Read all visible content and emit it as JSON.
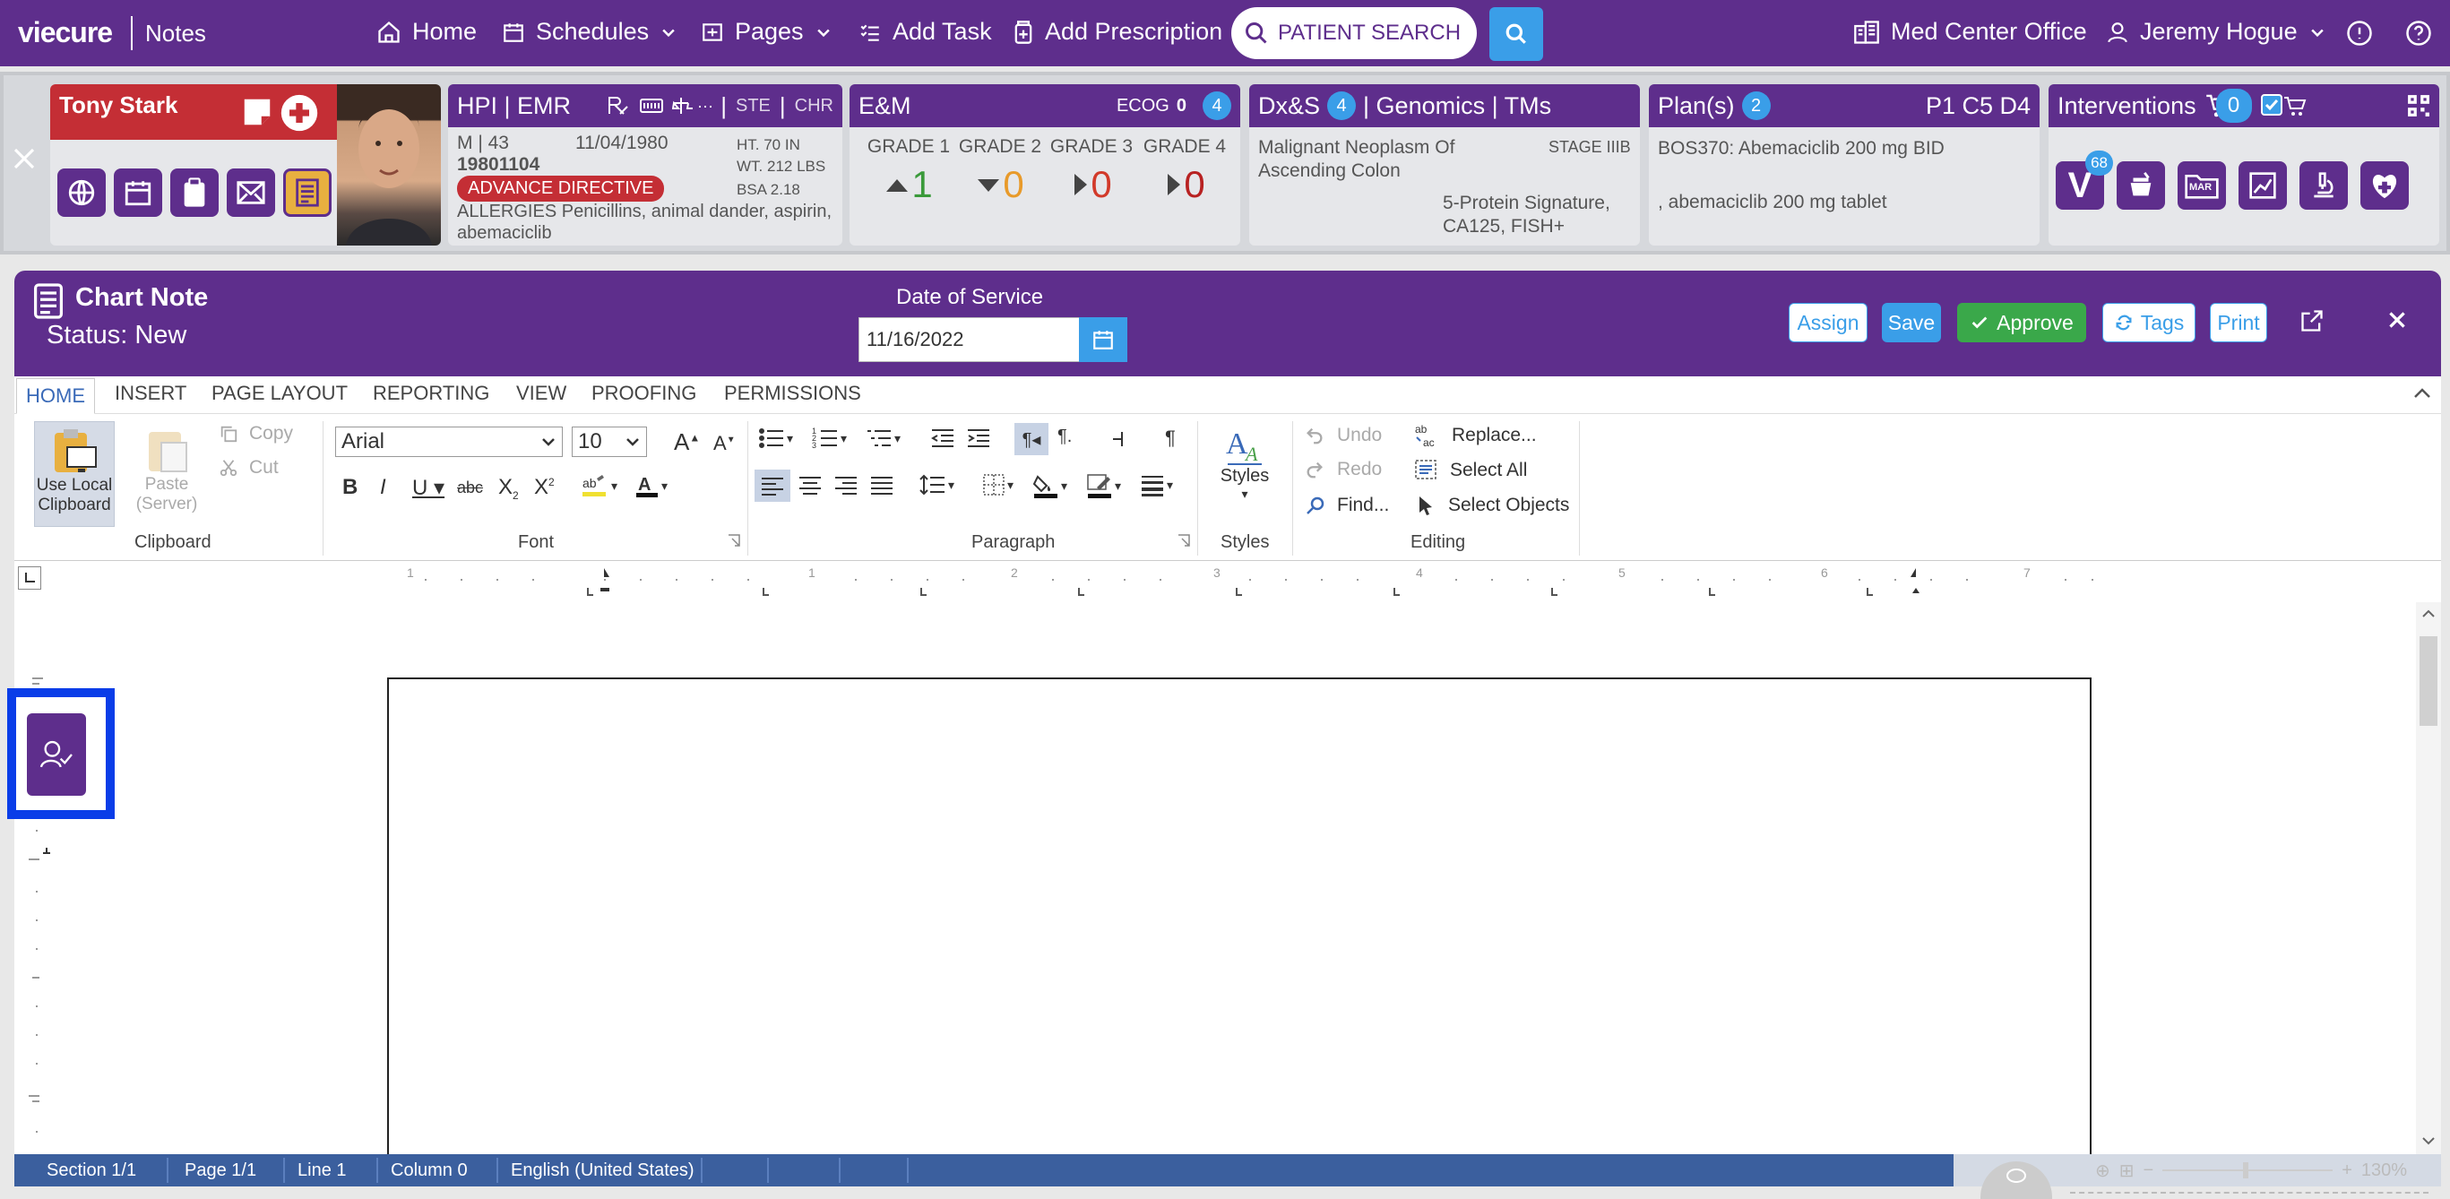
{
  "nav": {
    "logo": "viecure",
    "app": "Notes",
    "items": [
      {
        "label": "Home",
        "icon": "home-icon"
      },
      {
        "label": "Schedules",
        "icon": "calendar-icon"
      },
      {
        "label": "Pages",
        "icon": "pages-icon"
      },
      {
        "label": "Add Task",
        "icon": "checklist-icon"
      },
      {
        "label": "Add Prescription",
        "icon": "prescription-icon"
      }
    ],
    "search_placeholder": "PATIENT SEARCH",
    "office": "Med Center Office",
    "user": "Jeremy Hogue",
    "colors": {
      "primary": "#5e2e8c",
      "accent": "#3a9ee8"
    }
  },
  "patient": {
    "name": "Tony Stark",
    "hpi": {
      "title": "HPI | EMR",
      "ste": "STE",
      "chr": "CHR",
      "sex_age": "M | 43",
      "dob": "11/04/1980",
      "mrn": "19801104",
      "ht": "HT. 70 IN",
      "wt": "WT. 212 LBS",
      "bsa": "BSA 2.18",
      "directive": "ADVANCE DIRECTIVE",
      "allergies_label": "ALLERGIES",
      "allergies": "Penicillins, animal dander, aspirin, abemaciclib"
    },
    "em": {
      "title": "E&M",
      "ecog_label": "ECOG",
      "ecog": "0",
      "count": "4",
      "grades": [
        {
          "label": "GRADE 1",
          "value": "1",
          "color": "#3a9a3a"
        },
        {
          "label": "GRADE 2",
          "value": "0",
          "color": "#e89a2a"
        },
        {
          "label": "GRADE 3",
          "value": "0",
          "color": "#d23a2a"
        },
        {
          "label": "GRADE 4",
          "value": "0",
          "color": "#b82222"
        }
      ]
    },
    "dx": {
      "title_a": "Dx&S",
      "count": "4",
      "title_b": "| Genomics | TMs",
      "diagnosis": "Malignant Neoplasm Of Ascending Colon",
      "stage": "STAGE IIIB",
      "genomics": "5-Protein Signature, CA125, FISH+"
    },
    "plan": {
      "title": "Plan(s)",
      "count": "2",
      "cycle": "P1 C5 D4",
      "line1": "BOS370: Abemaciclib 200 mg BID",
      "line2": ", abemaciclib 200 mg tablet"
    },
    "interventions": {
      "title": "Interventions",
      "cart_count": "0",
      "v_badge": "68",
      "mar": "MAR"
    }
  },
  "note": {
    "title": "Chart Note",
    "status": "Status: New",
    "dos_label": "Date of Service",
    "dos": "11/16/2022",
    "buttons": {
      "assign": "Assign",
      "save": "Save",
      "approve": "Approve",
      "tags": "Tags",
      "print": "Print"
    }
  },
  "ribbon": {
    "tabs": [
      "HOME",
      "INSERT",
      "PAGE LAYOUT",
      "REPORTING",
      "VIEW",
      "PROOFING",
      "PERMISSIONS"
    ],
    "clipboard": {
      "use_local": "Use Local Clipboard",
      "paste": "Paste (Server)",
      "copy": "Copy",
      "cut": "Cut",
      "label": "Clipboard"
    },
    "font": {
      "family": "Arial",
      "size": "10",
      "label": "Font"
    },
    "paragraph": {
      "label": "Paragraph"
    },
    "styles": {
      "button": "Styles",
      "label": "Styles"
    },
    "editing": {
      "undo": "Undo",
      "redo": "Redo",
      "find": "Find...",
      "replace": "Replace...",
      "select_all": "Select All",
      "select_objects": "Select Objects",
      "label": "Editing"
    }
  },
  "statusbar": {
    "section": "Section 1/1",
    "page": "Page 1/1",
    "line": "Line 1",
    "column": "Column 0",
    "language": "English (United States)",
    "zoom": "130%"
  }
}
